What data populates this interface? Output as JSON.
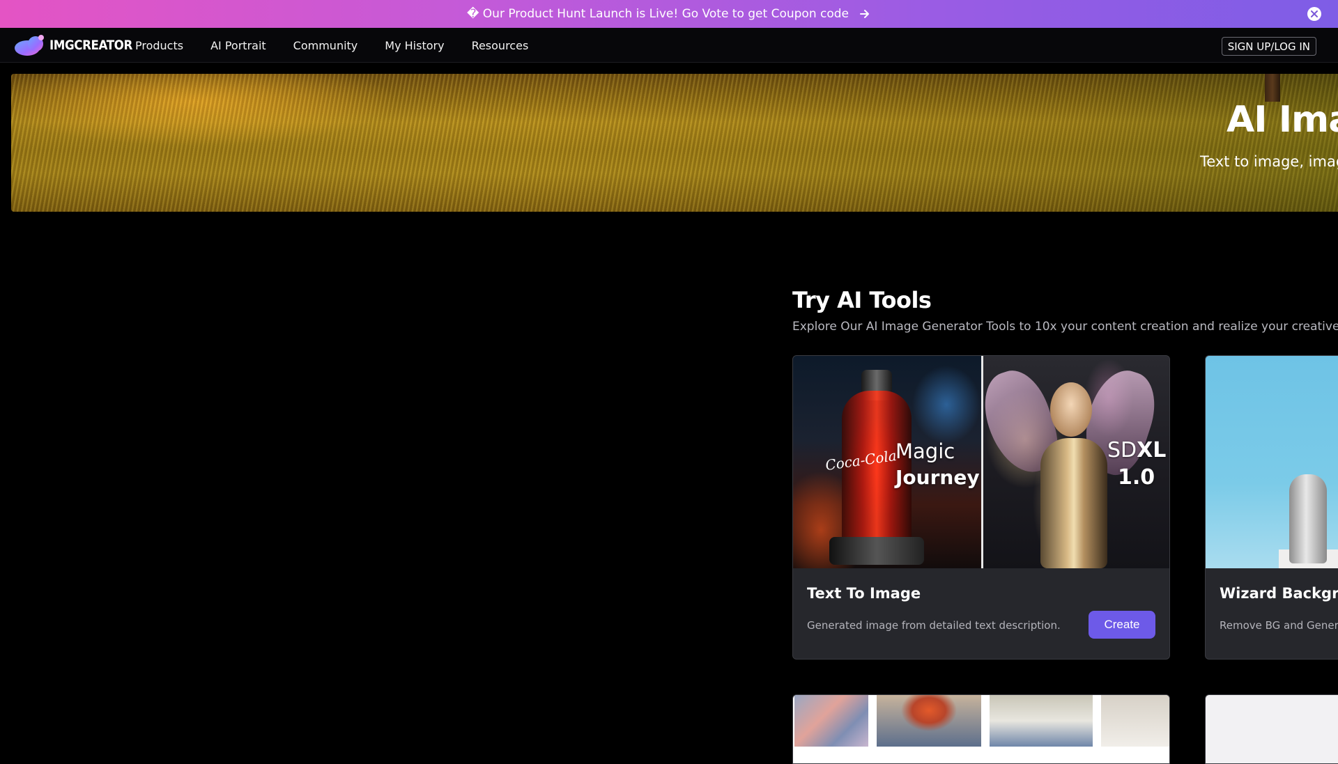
{
  "promo": {
    "text": "� Our Product Hunt Launch is Live! Go Vote to get Coupon code",
    "icons": [
      "arrow-right-icon",
      "close-icon"
    ]
  },
  "nav": {
    "brand": "IMGCREATOR",
    "menu": [
      "Products",
      "AI Portrait",
      "Community",
      "My History",
      "Resources"
    ],
    "auth_button": "SIGN UP/LOG IN"
  },
  "hero": {
    "title": "AI Imag",
    "subtitle": "Text to image, imag"
  },
  "tools_section": {
    "title": "Try AI Tools",
    "subtitle": "Explore Our AI Image Generator Tools to 10x your content creation and realize your creative vision",
    "cards": [
      {
        "title": "Text To Image",
        "description": "Generated image from detailed text description.",
        "button": "Create",
        "overlay_left": [
          "Magic",
          "Journey"
        ],
        "overlay_right": [
          "SD",
          "XL",
          "1.0"
        ],
        "label_in_image": "Coca-Cola"
      },
      {
        "title": "Wizard Backgrou",
        "description": "Remove BG and Generat"
      }
    ]
  },
  "colors": {
    "accent": "#6d5ae8",
    "promo_gradient_start": "#e454c4",
    "promo_gradient_end": "#7e5de6",
    "card_bg": "#26272c"
  }
}
